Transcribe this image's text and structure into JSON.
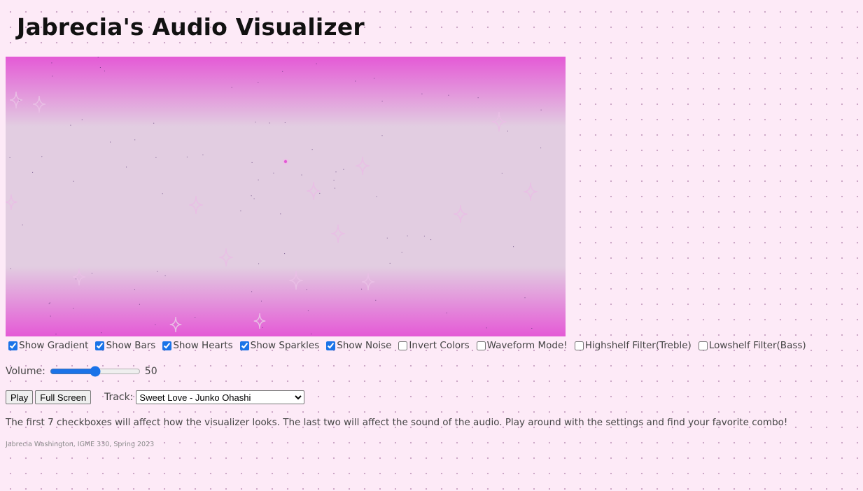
{
  "page": {
    "title": "Jabrecia's Audio Visualizer"
  },
  "visualizer": {
    "gradient_colors": [
      "#e45ad6",
      "#e2cde1",
      "#e2cde1",
      "#e45ad6"
    ],
    "sparkle_color": "#e9bfe5",
    "noise_color": "#4a2a6a"
  },
  "checkboxes": [
    {
      "label": "Show Gradient",
      "checked": true
    },
    {
      "label": "Show Bars",
      "checked": true
    },
    {
      "label": "Show Hearts",
      "checked": true
    },
    {
      "label": "Show Sparkles",
      "checked": true
    },
    {
      "label": "Show Noise",
      "checked": true
    },
    {
      "label": "Invert Colors",
      "checked": false
    },
    {
      "label": "Waveform Mode!",
      "checked": false
    },
    {
      "label": "Highshelf Filter(Treble)",
      "checked": false
    },
    {
      "label": "Lowshelf Filter(Bass)",
      "checked": false
    }
  ],
  "volume": {
    "label": "Volume:",
    "value": 50,
    "value_text": "50",
    "min": 0,
    "max": 100
  },
  "buttons": {
    "play_label": "Play",
    "fullscreen_label": "Full Screen"
  },
  "track": {
    "label": "Track:",
    "selected": "Sweet Love - Junko Ohashi"
  },
  "description": "The first 7 checkboxes will affect how the visualizer looks. The last two will affect the sound of the audio. Play around with the settings and find your favorite combo!",
  "credit": "Jabrecia Washington, IGME 330, Spring 2023"
}
